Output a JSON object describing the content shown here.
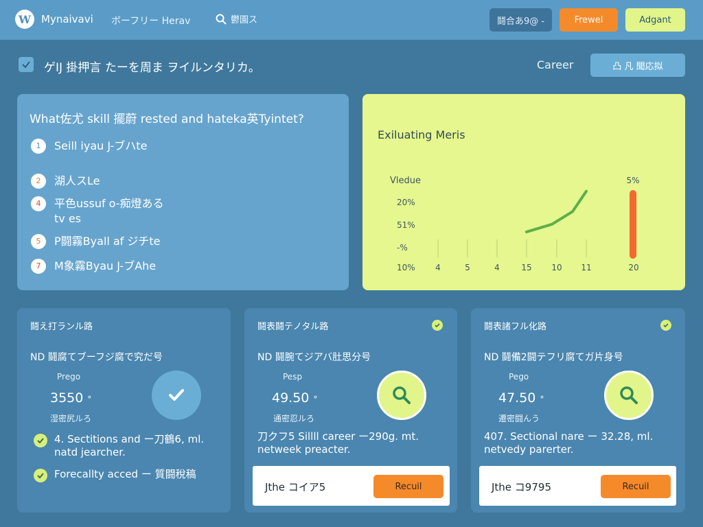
{
  "topbar": {
    "brand": "Mynaivavi",
    "logo_letter": "W",
    "nav_link": "ボーフリー Herav",
    "search_label": "鬱園ス",
    "lang_button": "鬪合あ9@ -",
    "orange_button": "Frewel",
    "lime_button": "Adgant"
  },
  "subrow": {
    "title": "ゲIJ 掛押言 たーを周ま ヲイルンタリカ。",
    "career_label": "Career",
    "career_button": "凸 凡 聞応拟"
  },
  "question_card": {
    "title": "What佐尤 skill 擺蔚 rested and hateka英Tyintet?",
    "items": [
      {
        "num": "1",
        "text": "Seill iyau J-ブハte"
      },
      {
        "num": "2",
        "text": "湖人スLe"
      },
      {
        "num": "4",
        "text": "平色ussuf o-痴燈ある\ntv es"
      },
      {
        "num": "5",
        "text": "P闘霧Byall af ジチte"
      },
      {
        "num": "7",
        "text": "M象霧Byau J-ブAhe"
      }
    ]
  },
  "chart": {
    "title": "Exiluating Meris",
    "colors": {
      "line": "#5fae4b",
      "bar": "#f26a2e",
      "text": "#3e5660",
      "grid": "#b9cf74"
    },
    "chart_data": {
      "type": "line",
      "title": "Exiluating Meris",
      "ylabel": "Vledue",
      "y_tick_labels": [
        "20%",
        "51%",
        "-%",
        "10%"
      ],
      "x_tick_labels": [
        "4",
        "5",
        "4",
        "15",
        "10",
        "11",
        "20"
      ],
      "series": [
        {
          "type": "line",
          "values": [
            {
              "x": "15",
              "y": 0.15
            },
            {
              "x": "10",
              "y": 0.3
            },
            {
              "x": "-",
              "y": 0.55
            },
            {
              "x": "11",
              "y": 0.95
            }
          ]
        },
        {
          "type": "bar",
          "x": "20",
          "value": 1.0,
          "label": "5%"
        }
      ]
    }
  },
  "bottom_cards": [
    {
      "head": "鬪え打ランル路",
      "sub": "ND 鬪腐てブーフジ腐で究だ号",
      "price_label": "Prego",
      "price": "3550",
      "price_mark": "°",
      "unit": "湿密尻ルろ",
      "features": [
        {
          "text": "4. Sectitions and ー刀鶴6, ml.\nnatd jearcher."
        },
        {
          "text": "Forecallty acced ー 質闘稅稿"
        }
      ]
    },
    {
      "head": "鬪表鬪テノタル路",
      "sub": "ND 鬪腕てジアバ肚思分号",
      "price_label": "Pesp",
      "price": "49.50",
      "price_mark": "°",
      "unit": "通密忍ルろ",
      "desc": "刀クフ5 Sillll career ー290g. mt.\nnetweek preacter.",
      "footer_text": "Jthe コイア5",
      "button": "Recuil"
    },
    {
      "head": "鬪表諸フル化路",
      "sub": "ND 鬪備2闘テフリ腐てガ片身号",
      "price_label": "Pego",
      "price": "47.50",
      "price_mark": "°",
      "unit": "遷密闘んう",
      "desc": "407. Sectional nare ー 32.28, ml.\nnetvedy parerter.",
      "footer_text": "Jthe コ9795",
      "button": "Recuil"
    }
  ]
}
